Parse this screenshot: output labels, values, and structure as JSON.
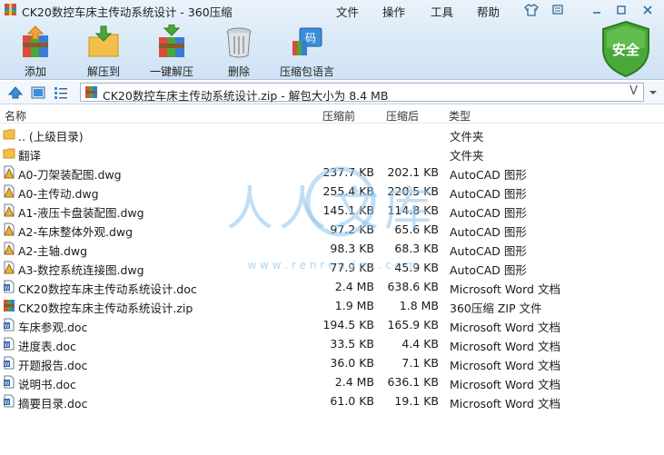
{
  "window": {
    "title": "CK20数控车床主传动系统设计 - 360压缩",
    "menu": [
      "文件",
      "操作",
      "工具",
      "帮助"
    ]
  },
  "toolbar": {
    "items": [
      {
        "label": "添加",
        "icon": "add-books-icon"
      },
      {
        "label": "解压到",
        "icon": "extract-folder-icon"
      },
      {
        "label": "一键解压",
        "icon": "one-click-extract-icon"
      },
      {
        "label": "删除",
        "icon": "trash-can-icon"
      },
      {
        "label": "压缩包语言",
        "icon": "archive-language-icon"
      }
    ],
    "safety_label": "安全"
  },
  "address": {
    "path": "CK20数控车床主传动系统设计.zip - 解包大小为 8.4 MB",
    "dropdown_glyph": "V"
  },
  "columns": {
    "name": "名称",
    "size": "压缩前",
    "compressed": "压缩后",
    "type": "类型"
  },
  "files": [
    {
      "name": ".. (上级目录)",
      "size": "",
      "compressed": "",
      "type": "文件夹",
      "icon": "folder"
    },
    {
      "name": "翻译",
      "size": "",
      "compressed": "",
      "type": "文件夹",
      "icon": "folder"
    },
    {
      "name": "A0-刀架装配图.dwg",
      "size": "237.7 KB",
      "compressed": "202.1 KB",
      "type": "AutoCAD 图形",
      "icon": "dwg"
    },
    {
      "name": "A0-主传动.dwg",
      "size": "255.4 KB",
      "compressed": "220.5 KB",
      "type": "AutoCAD 图形",
      "icon": "dwg"
    },
    {
      "name": "A1-液压卡盘装配图.dwg",
      "size": "145.1 KB",
      "compressed": "114.8 KB",
      "type": "AutoCAD 图形",
      "icon": "dwg"
    },
    {
      "name": "A2-车床整体外观.dwg",
      "size": "97.2 KB",
      "compressed": "65.6 KB",
      "type": "AutoCAD 图形",
      "icon": "dwg"
    },
    {
      "name": "A2-主轴.dwg",
      "size": "98.3 KB",
      "compressed": "68.3 KB",
      "type": "AutoCAD 图形",
      "icon": "dwg"
    },
    {
      "name": "A3-数控系统连接图.dwg",
      "size": "77.9 KB",
      "compressed": "45.9 KB",
      "type": "AutoCAD 图形",
      "icon": "dwg"
    },
    {
      "name": "CK20数控车床主传动系统设计.doc",
      "size": "2.4 MB",
      "compressed": "638.6 KB",
      "type": "Microsoft Word 文档",
      "icon": "doc"
    },
    {
      "name": "CK20数控车床主传动系统设计.zip",
      "size": "1.9 MB",
      "compressed": "1.8 MB",
      "type": "360压缩 ZIP 文件",
      "icon": "zip"
    },
    {
      "name": "车床参观.doc",
      "size": "194.5 KB",
      "compressed": "165.9 KB",
      "type": "Microsoft Word 文档",
      "icon": "doc"
    },
    {
      "name": "进度表.doc",
      "size": "33.5 KB",
      "compressed": "4.4 KB",
      "type": "Microsoft Word 文档",
      "icon": "doc"
    },
    {
      "name": "开题报告.doc",
      "size": "36.0 KB",
      "compressed": "7.1 KB",
      "type": "Microsoft Word 文档",
      "icon": "doc"
    },
    {
      "name": "说明书.doc",
      "size": "2.4 MB",
      "compressed": "636.1 KB",
      "type": "Microsoft Word 文档",
      "icon": "doc"
    },
    {
      "name": "摘要目录.doc",
      "size": "61.0 KB",
      "compressed": "19.1 KB",
      "type": "Microsoft Word 文档",
      "icon": "doc"
    }
  ],
  "watermark": {
    "text": "人人文库",
    "url": "w w w . r e n r e n d o c . c o m"
  },
  "colors": {
    "accent": "#2f7fd0",
    "shield": "#4aa83a",
    "folder": "#f2c04a",
    "watermark": "#8fc4ec"
  }
}
